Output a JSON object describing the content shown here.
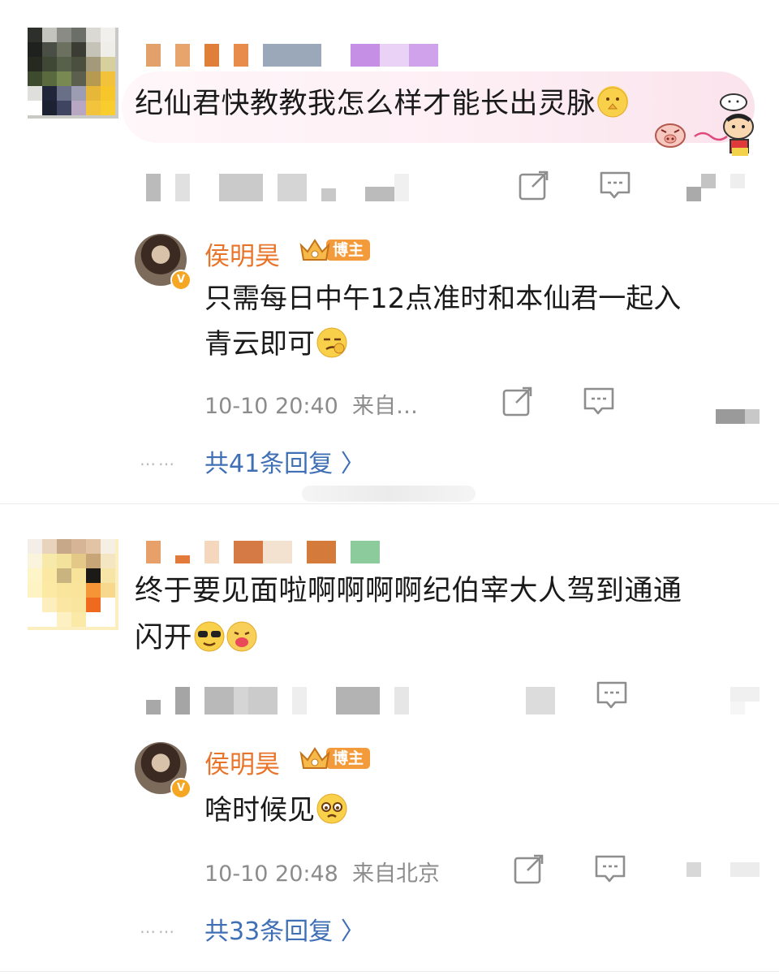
{
  "comments": [
    {
      "text": "纪仙君快教教我怎么样才能长出灵脉",
      "reply": {
        "author": "侯明昊",
        "badge": "博主",
        "text_line1": "只需每日中午12点准时和本仙君一起入",
        "text_line2": "青云即可",
        "time": "10-10 20:40",
        "source": "来自…",
        "more_replies": "共41条回复 〉"
      }
    },
    {
      "text_line1": "终于要见面啦啊啊啊啊纪伯宰大人驾到通通",
      "text_line2": "闪开",
      "reply": {
        "author": "侯明昊",
        "badge": "博主",
        "text": "啥时候见",
        "time": "10-10 20:48",
        "source": "来自北京",
        "more_replies": "共33条回复 〉"
      }
    }
  ],
  "icons": {
    "share": "share-icon",
    "comment": "comment-icon",
    "like": "like-icon",
    "verified": "verified-badge-icon"
  },
  "colors": {
    "blogger_name": "#e8742a",
    "badge": "#f39a3b",
    "link": "#3f6fb5",
    "meta": "#8c8c8c"
  },
  "dots": "……"
}
